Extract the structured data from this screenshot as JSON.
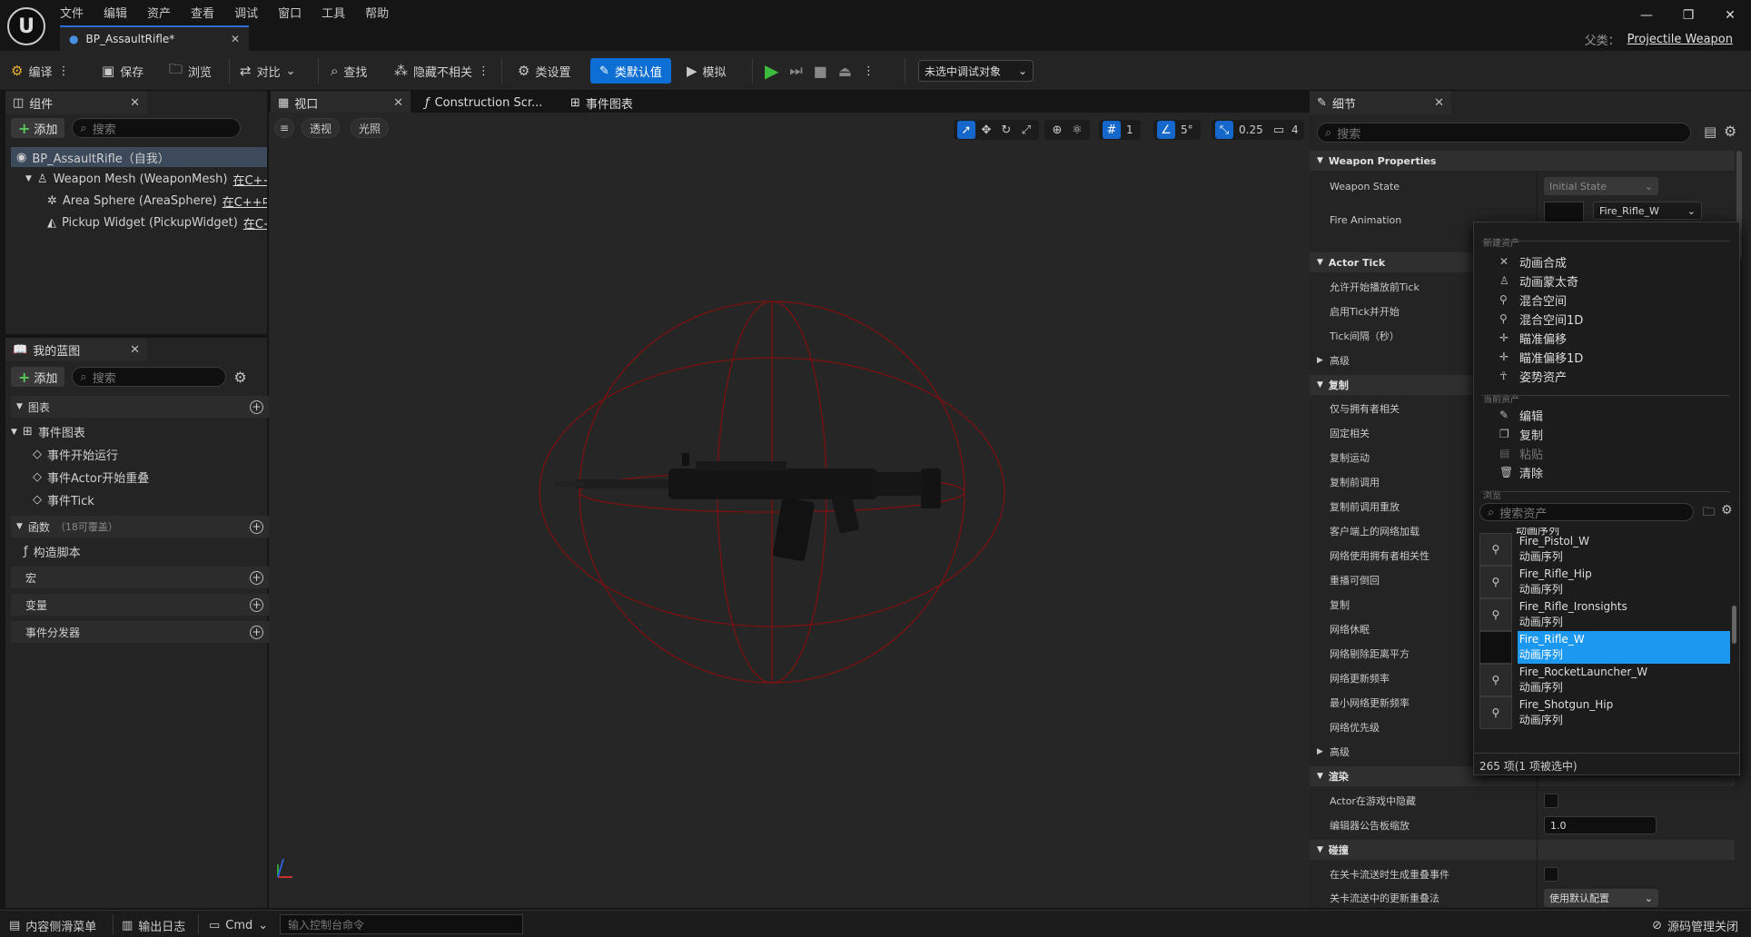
{
  "app": {
    "menu": [
      "文件",
      "编辑",
      "资产",
      "查看",
      "调试",
      "窗口",
      "工具",
      "帮助"
    ],
    "doc_tab": "BP_AssaultRifle*",
    "parent_label": "父类：",
    "parent_class": "Projectile Weapon",
    "window_controls": [
      "—",
      "❐",
      "✕"
    ]
  },
  "toolbar": {
    "compile": "编译",
    "save": "保存",
    "browse": "浏览",
    "diff": "对比",
    "find": "查找",
    "hide_unrelated": "隐藏不相关",
    "class_settings": "类设置",
    "class_defaults": "类默认值",
    "simulate": "模拟",
    "debug_target": "未选中调试对象"
  },
  "components": {
    "tab": "组件",
    "add": "添加",
    "search_placeholder": "搜索",
    "root": "BP_AssaultRifle（自我）",
    "items": [
      {
        "label": "Weapon Mesh (WeaponMesh)",
        "cpp": "在C++中"
      },
      {
        "label": "Area Sphere (AreaSphere)",
        "cpp": "在C++中编"
      },
      {
        "label": "Pickup Widget (PickupWidget)",
        "cpp": "在C++中"
      }
    ]
  },
  "my_blueprint": {
    "tab": "我的蓝图",
    "add": "添加",
    "search_placeholder": "搜索",
    "graphs_header": "图表",
    "event_graph": "事件图表",
    "events": [
      "事件开始运行",
      "事件Actor开始重叠",
      "事件Tick"
    ],
    "functions_header": "函数",
    "functions_note": "（18可覆盖）",
    "construction_script": "构造脚本",
    "macros_header": "宏",
    "variables_header": "变量",
    "dispatchers_header": "事件分发器"
  },
  "editor_tabs": [
    "视口",
    "Construction Scr...",
    "事件图表"
  ],
  "viewport": {
    "perspective": "透视",
    "lighting": "光照",
    "grid_snap": "1",
    "rot_snap": "5°",
    "scale_snap": "0.25",
    "camera_speed": "4"
  },
  "details": {
    "tab": "细节",
    "search_placeholder": "搜索",
    "categories": {
      "weapon_properties": "Weapon Properties",
      "actor_tick": "Actor Tick",
      "advanced1": "高级",
      "replication": "复制",
      "advanced2": "高级",
      "rendering": "渲染",
      "collision": "碰撞"
    },
    "weapon_state_label": "Weapon State",
    "weapon_state_value": "Initial State",
    "fire_animation_label": "Fire Animation",
    "fire_animation_value": "Fire_Rifle_W",
    "tick_rows": [
      "允许开始播放前Tick",
      "启用Tick并开始",
      "Tick间隔（秒）"
    ],
    "replication_rows": [
      "仅与拥有者相关",
      "固定相关",
      "复制运动",
      "复制前调用",
      "复制前调用重放",
      "客户端上的网络加载",
      "网络使用拥有者相关性",
      "重播可倒回",
      "复制",
      "网络休眠",
      "网络剔除距离平方",
      "网络更新频率",
      "最小网络更新频率",
      "网络优先级"
    ],
    "render_rows": [
      "Actor在游戏中隐藏",
      "编辑器公告板缩放"
    ],
    "billboard_scale": "1.0",
    "collision_rows": [
      "在关卡流送时生成重叠事件",
      "关卡流送中的更新重叠法"
    ],
    "collision_dropdown": "使用默认配置"
  },
  "popup": {
    "new_asset_header": "新建资产",
    "new_items": [
      "动画合成",
      "动画蒙太奇",
      "混合空间",
      "混合空间1D",
      "瞄准偏移",
      "瞄准偏移1D",
      "姿势资产"
    ],
    "current_asset_header": "当前资产",
    "current_items": [
      "编辑",
      "复制",
      "粘贴",
      "清除"
    ],
    "browse_header": "浏览",
    "search_placeholder": "搜索资产",
    "partial_top": "动画序列",
    "assets": [
      {
        "name": "Fire_Pistol_W",
        "type": "动画序列",
        "selected": false
      },
      {
        "name": "Fire_Rifle_Hip",
        "type": "动画序列",
        "selected": false
      },
      {
        "name": "Fire_Rifle_Ironsights",
        "type": "动画序列",
        "selected": false
      },
      {
        "name": "Fire_Rifle_W",
        "type": "动画序列",
        "selected": true
      },
      {
        "name": "Fire_RocketLauncher_W",
        "type": "动画序列",
        "selected": false
      },
      {
        "name": "Fire_Shotgun_Hip",
        "type": "动画序列",
        "selected": false
      }
    ],
    "count": "265 项(1 项被选中)"
  },
  "statusbar": {
    "content_drawer": "内容侧滑菜单",
    "output_log": "输出日志",
    "cmd": "Cmd",
    "console_placeholder": "输入控制台命令",
    "source_control": "源码管理关闭"
  },
  "colors": {
    "accent": "#0d6fd4",
    "selection": "#1c98f0",
    "play": "#3cbc3c",
    "sphere": "#8a1010"
  }
}
